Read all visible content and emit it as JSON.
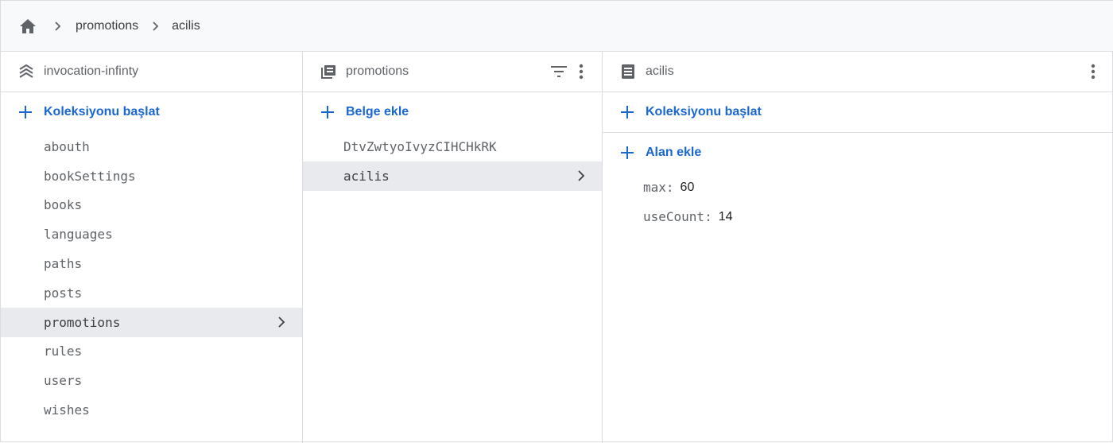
{
  "breadcrumb": {
    "home_icon": "home-icon",
    "items": [
      "promotions",
      "acilis"
    ]
  },
  "panel_root": {
    "icon": "database-layers-icon",
    "title": "invocation-infinty",
    "add_label": "Koleksiyonu başlat",
    "items": [
      {
        "label": "abouth"
      },
      {
        "label": "bookSettings"
      },
      {
        "label": "books"
      },
      {
        "label": "languages"
      },
      {
        "label": "paths"
      },
      {
        "label": "posts"
      },
      {
        "label": "promotions",
        "selected": true
      },
      {
        "label": "rules"
      },
      {
        "label": "users"
      },
      {
        "label": "wishes"
      }
    ]
  },
  "panel_collection": {
    "icon": "collection-icon",
    "title": "promotions",
    "add_label": "Belge ekle",
    "items": [
      {
        "label": "DtvZwtyoIvyzCIHCHkRK"
      },
      {
        "label": "acilis",
        "selected": true
      }
    ]
  },
  "panel_document": {
    "icon": "document-icon",
    "title": "acilis",
    "add_collection_label": "Koleksiyonu başlat",
    "add_field_label": "Alan ekle",
    "fields": [
      {
        "key": "max",
        "value": "60"
      },
      {
        "key": "useCount",
        "value": "14"
      }
    ]
  },
  "colors": {
    "accent": "#1967d2",
    "selected_bg": "#e8eaed",
    "border": "#dadce0",
    "header_bg": "#f8f9fa"
  }
}
